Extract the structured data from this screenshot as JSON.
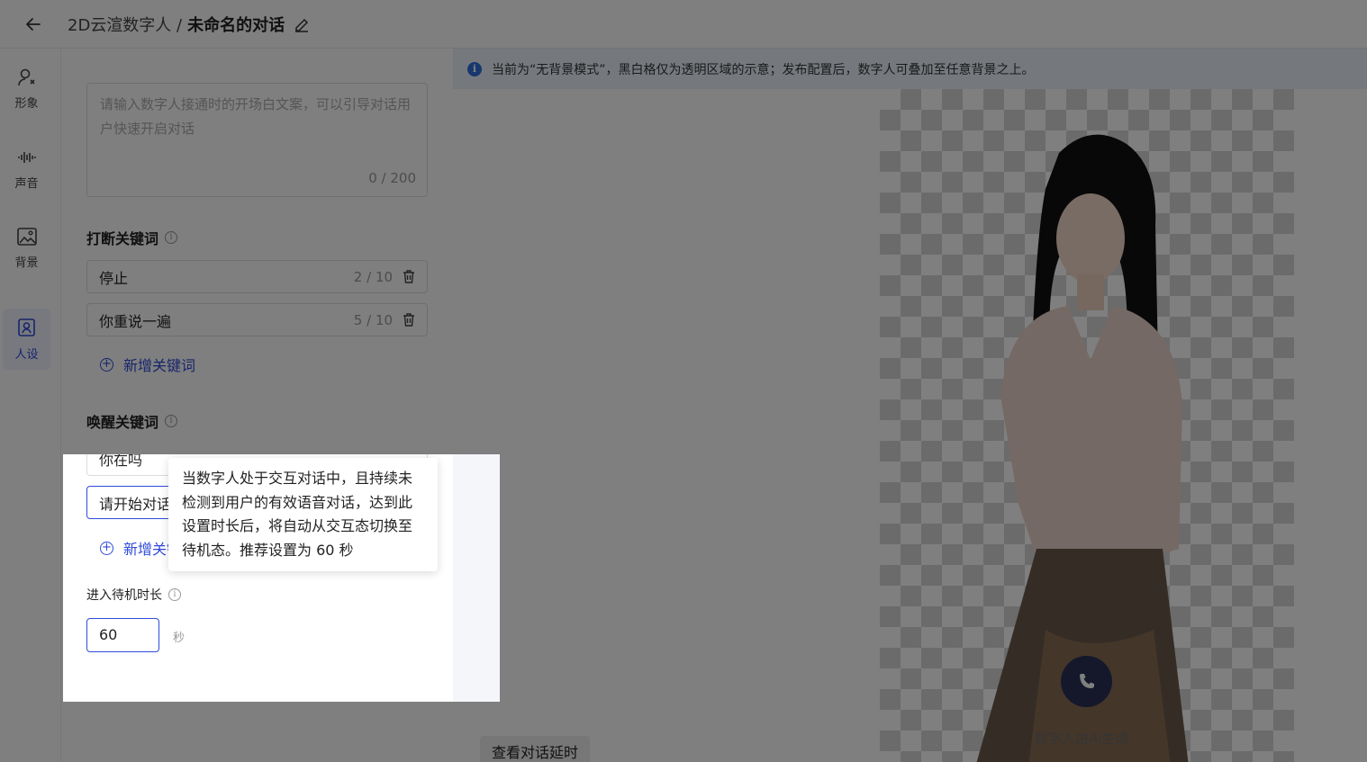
{
  "header": {
    "breadcrumb": "2D云渲数字人 /",
    "title": "未命名的对话"
  },
  "sidebar": {
    "items": [
      {
        "label": "形象",
        "icon": "person-icon",
        "active": false
      },
      {
        "label": "声音",
        "icon": "waveform-icon",
        "active": false
      },
      {
        "label": "背景",
        "icon": "image-icon",
        "active": false
      },
      {
        "label": "人设",
        "icon": "persona-icon",
        "active": true
      }
    ]
  },
  "panel": {
    "opening": {
      "placeholder": "请输入数字人接通时的开场白文案，可以引导对话用户快速开启对话",
      "counter": "0 / 200"
    },
    "interrupt": {
      "title": "打断关键词",
      "keywords": [
        {
          "text": "停止",
          "count": "2 / 10"
        },
        {
          "text": "你重说一遍",
          "count": "5 / 10"
        }
      ],
      "add_label": "新增关键词"
    },
    "wake": {
      "title": "唤醒关键词",
      "keywords": [
        {
          "text": "你在吗"
        },
        {
          "text": "请开始对话"
        }
      ],
      "add_label": "新增关键词"
    },
    "standby": {
      "label": "进入待机时长",
      "value": "60",
      "unit": "秒"
    }
  },
  "tooltip": {
    "text": "当数字人处于交互对话中，且持续未检测到用户的有效语音对话，达到此设置时长后，将自动从交互态切换至待机态。推荐设置为 60 秒"
  },
  "preview": {
    "notice": "当前为“无背景模式”，黑白格仅为透明区域的示意；发布配置后，数字人可叠加至任意背景之上。",
    "watermark": "数字人由AI生成",
    "latency_button": "查看对话延时"
  },
  "colors": {
    "accent": "#2f4bd8",
    "call_button": "#2b3057",
    "notice_bg": "#eaf3fd"
  }
}
